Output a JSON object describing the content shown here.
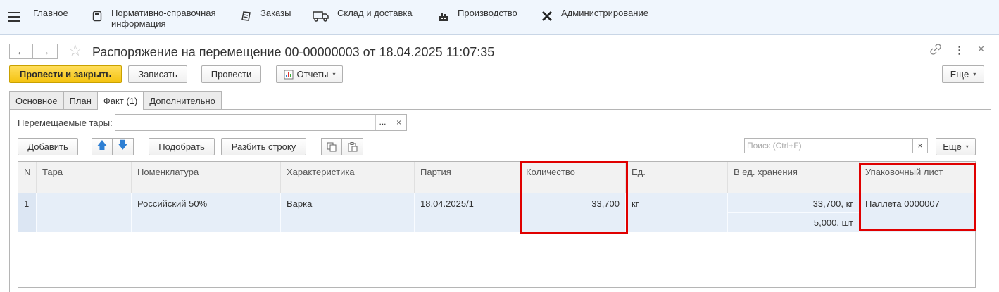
{
  "menu": {
    "items": [
      {
        "label": "Главное",
        "icon": "hamburger-list-icon"
      },
      {
        "label": "Нормативно-справочная\nинформация",
        "icon": "book-icon"
      },
      {
        "label": "Заказы",
        "icon": "clipboard-icon"
      },
      {
        "label": "Склад и доставка",
        "icon": "truck-icon"
      },
      {
        "label": "Производство",
        "icon": "factory-icon"
      },
      {
        "label": "Администрирование",
        "icon": "tools-icon"
      }
    ]
  },
  "nav": {
    "back": "←",
    "forward": "→"
  },
  "document": {
    "title": "Распоряжение на перемещение 00-00000003 от 18.04.2025 11:07:35"
  },
  "toolbar": {
    "post_close": "Провести и закрыть",
    "save": "Записать",
    "post": "Провести",
    "reports": "Отчеты",
    "more": "Еще"
  },
  "tabs": [
    {
      "label": "Основное",
      "active": false
    },
    {
      "label": "План",
      "active": false
    },
    {
      "label": "Факт (1)",
      "active": true
    },
    {
      "label": "Дополнительно",
      "active": false
    }
  ],
  "containers_field": {
    "label": "Перемещаемые тары:",
    "value": "",
    "ellipsis": "...",
    "clear": "×"
  },
  "table_toolbar": {
    "add": "Добавить",
    "pick": "Подобрать",
    "split": "Разбить строку",
    "search_placeholder": "Поиск (Ctrl+F)",
    "search_clear": "×",
    "more": "Еще"
  },
  "table": {
    "headers": [
      "N",
      "Тара",
      "Номенклатура",
      "Характеристика",
      "Партия",
      "Количество",
      "Ед.",
      "В ед. хранения",
      "Упаковочный лист"
    ],
    "rows": [
      {
        "n": "1",
        "container": "",
        "item": "Российский 50%",
        "characteristic": "Варка",
        "batch": "18.04.2025/1",
        "quantity": "33,700",
        "unit": "кг",
        "storage_units": [
          "33,700, кг",
          "5,000, шт"
        ],
        "packing_list": "Паллета 0000007"
      }
    ]
  },
  "colors": {
    "accent": "#f4c20f",
    "highlight": "#e00000",
    "selection": "#e6eef8"
  }
}
